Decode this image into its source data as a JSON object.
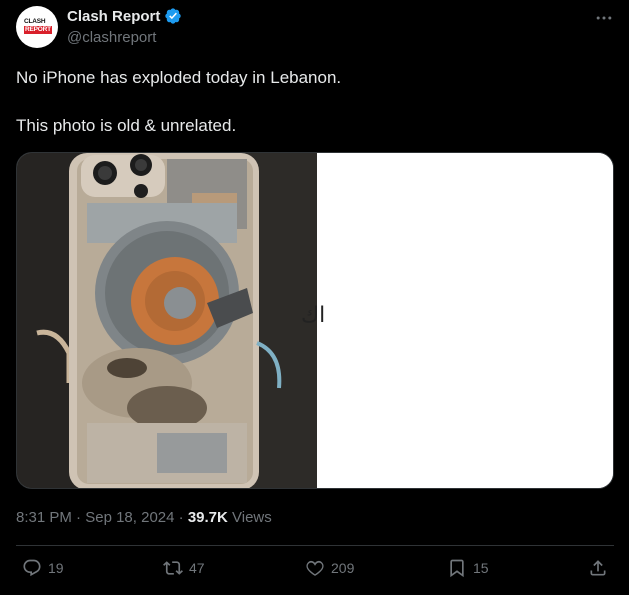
{
  "author": {
    "display_name": "Clash Report",
    "handle": "@clashreport",
    "avatar_logo_line1": "CLASH",
    "avatar_logo_line2": "REPORT",
    "verified": true
  },
  "tweet": {
    "paragraphs": [
      "No iPhone has exploded today in Lebanon.",
      "This photo is old & unrelated."
    ],
    "media_right_text": "اك"
  },
  "meta": {
    "time": "8:31 PM",
    "separator": "·",
    "date": "Sep 18, 2024",
    "views_count": "39.7K",
    "views_label": "Views"
  },
  "actions": {
    "replies": "19",
    "reposts": "47",
    "likes": "209",
    "bookmarks": "15"
  },
  "colors": {
    "background": "#000000",
    "text": "#e7e9ea",
    "muted": "#71767b",
    "border": "#2f3336",
    "verified": "#1d9bf0",
    "brand_red": "#d9202b"
  },
  "icons": {
    "more": "more-icon",
    "reply": "reply-icon",
    "repost": "repost-icon",
    "like": "heart-icon",
    "bookmark": "bookmark-icon",
    "share": "share-icon"
  }
}
